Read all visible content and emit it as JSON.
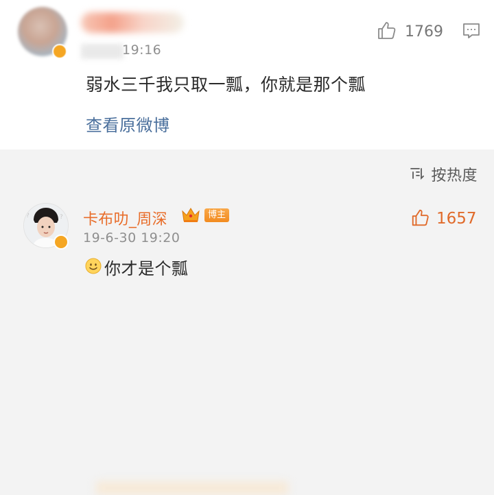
{
  "post": {
    "time": "19:16",
    "text": "弱水三千我只取一瓢，你就是那个瓢",
    "view_original": "查看原微博",
    "like_count": "1769"
  },
  "sort": {
    "label": "按热度"
  },
  "comment": {
    "author": "卡布叻_周深",
    "host_badge": "博主",
    "time": "19-6-30 19:20",
    "text": "你才是个瓢",
    "like_count": "1657"
  },
  "colors": {
    "author_name": "#e86d2a",
    "link": "#4a6f9c",
    "like_active": "#e06a2a",
    "host_badge": "#f28b1f"
  },
  "icons": {
    "post_like": "thumbs-up-icon",
    "post_comment": "comment-icon",
    "sort": "sort-icon",
    "crown": "crown-icon",
    "verified": "verified-icon",
    "emoji": "smile-emoji-icon",
    "comment_like": "thumbs-up-icon"
  }
}
